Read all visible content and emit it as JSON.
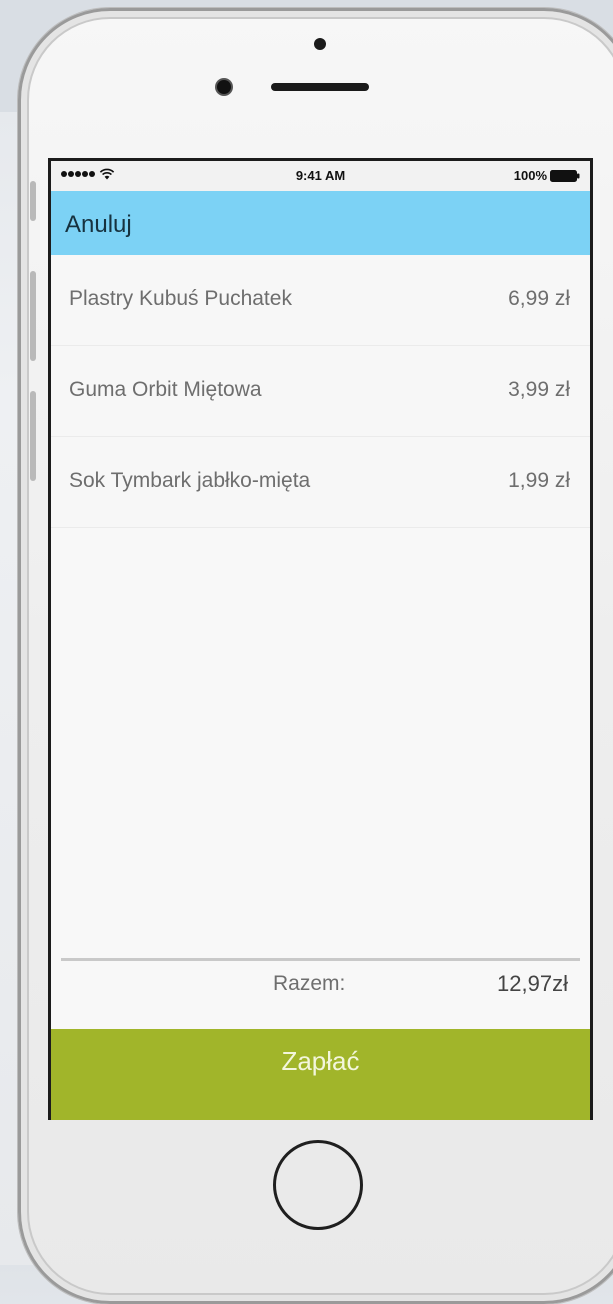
{
  "status_bar": {
    "time": "9:41 AM",
    "battery": "100%",
    "signal_icon": "signal-dots-icon",
    "wifi_icon": "wifi-icon",
    "battery_icon": "battery-icon"
  },
  "nav": {
    "cancel_label": "Anuluj",
    "color": "#7cd2f5"
  },
  "items": [
    {
      "name": "Plastry Kubuś Puchatek",
      "price": "6,99 zł"
    },
    {
      "name": "Guma Orbit Miętowa",
      "price": "3,99 zł"
    },
    {
      "name": "Sok Tymbark jabłko-mięta",
      "price": "1,99 zł"
    }
  ],
  "summary": {
    "total_label": "Razem:",
    "total_value": "12,97zł"
  },
  "pay": {
    "label": "Zapłać",
    "color": "#a1b52a"
  }
}
